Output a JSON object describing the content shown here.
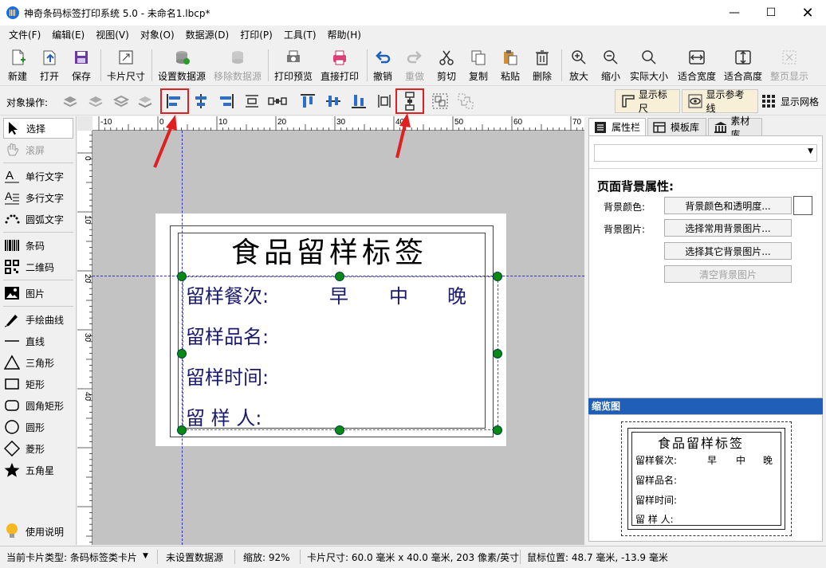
{
  "window": {
    "title": "神奇条码标签打印系统 5.0 - 未命名1.lbcp*"
  },
  "menu": [
    "文件(F)",
    "编辑(E)",
    "视图(V)",
    "对象(O)",
    "数据源(D)",
    "打印(P)",
    "工具(T)",
    "帮助(H)"
  ],
  "toolbar": {
    "new": "新建",
    "open": "打开",
    "save": "保存",
    "card_size": "卡片尺寸",
    "set_datasource": "设置数据源",
    "remove_datasource": "移除数据源",
    "print_preview": "打印预览",
    "direct_print": "直接打印",
    "undo": "撤销",
    "redo": "重做",
    "cut": "剪切",
    "copy": "复制",
    "paste": "粘贴",
    "delete": "删除",
    "zoom_in": "放大",
    "zoom_out": "缩小",
    "actual_size": "实际大小",
    "fit_width": "适合宽度",
    "fit_height": "适合高度",
    "full_page": "整页显示"
  },
  "ops": {
    "label": "对象操作:",
    "show_ruler": "显示标尺",
    "show_guides": "显示参考线",
    "show_grid": "显示网格"
  },
  "tools": {
    "select": "选择",
    "scroll": "滚屏",
    "single_text": "单行文字",
    "multi_text": "多行文字",
    "arc_text": "圆弧文字",
    "barcode": "条码",
    "qrcode": "二维码",
    "image": "图片",
    "freehand": "手绘曲线",
    "line": "直线",
    "triangle": "三角形",
    "rectangle": "矩形",
    "round_rect": "圆角矩形",
    "circle": "圆形",
    "diamond": "菱形",
    "star": "五角星",
    "help": "使用说明"
  },
  "ruler": {
    "h_labels": [
      "-10",
      "0",
      "10",
      "20",
      "30",
      "40",
      "50",
      "60",
      "70"
    ],
    "v_labels": [
      "0",
      "10",
      "20",
      "30",
      "40"
    ]
  },
  "label": {
    "title": "食品留样标签",
    "row1": "留样餐次:",
    "meal1": "早",
    "meal2": "中",
    "meal3": "晚",
    "row2": "留样品名:",
    "row3": "留样时间:",
    "row4": "留 样 人:"
  },
  "rightpanel": {
    "tabs": [
      "属性栏",
      "模板库",
      "素材库"
    ],
    "section_title": "页面背景属性:",
    "bg_color_label": "背景颜色:",
    "bg_color_btn": "背景颜色和透明度...",
    "bg_image_label": "背景图片:",
    "bg_common_btn": "选择常用背景图片...",
    "bg_other_btn": "选择其它背景图片...",
    "bg_clear_btn": "清空背景图片",
    "preview_title": "缩览图"
  },
  "status": {
    "card_type": "当前卡片类型: 条码标签类卡片",
    "datasource": "未设置数据源",
    "zoom": "缩放: 92%",
    "card_size": "卡片尺寸: 60.0 毫米 x 40.0 毫米, 203 像素/英寸",
    "mouse_pos": "鼠标位置: 48.7 毫米, -13.9 毫米"
  },
  "colors": {
    "accent_blue": "#1f5fb8",
    "label_text": "#1a1a6e",
    "handle_green": "#0a8a12",
    "highlight_red": "#e02020"
  }
}
